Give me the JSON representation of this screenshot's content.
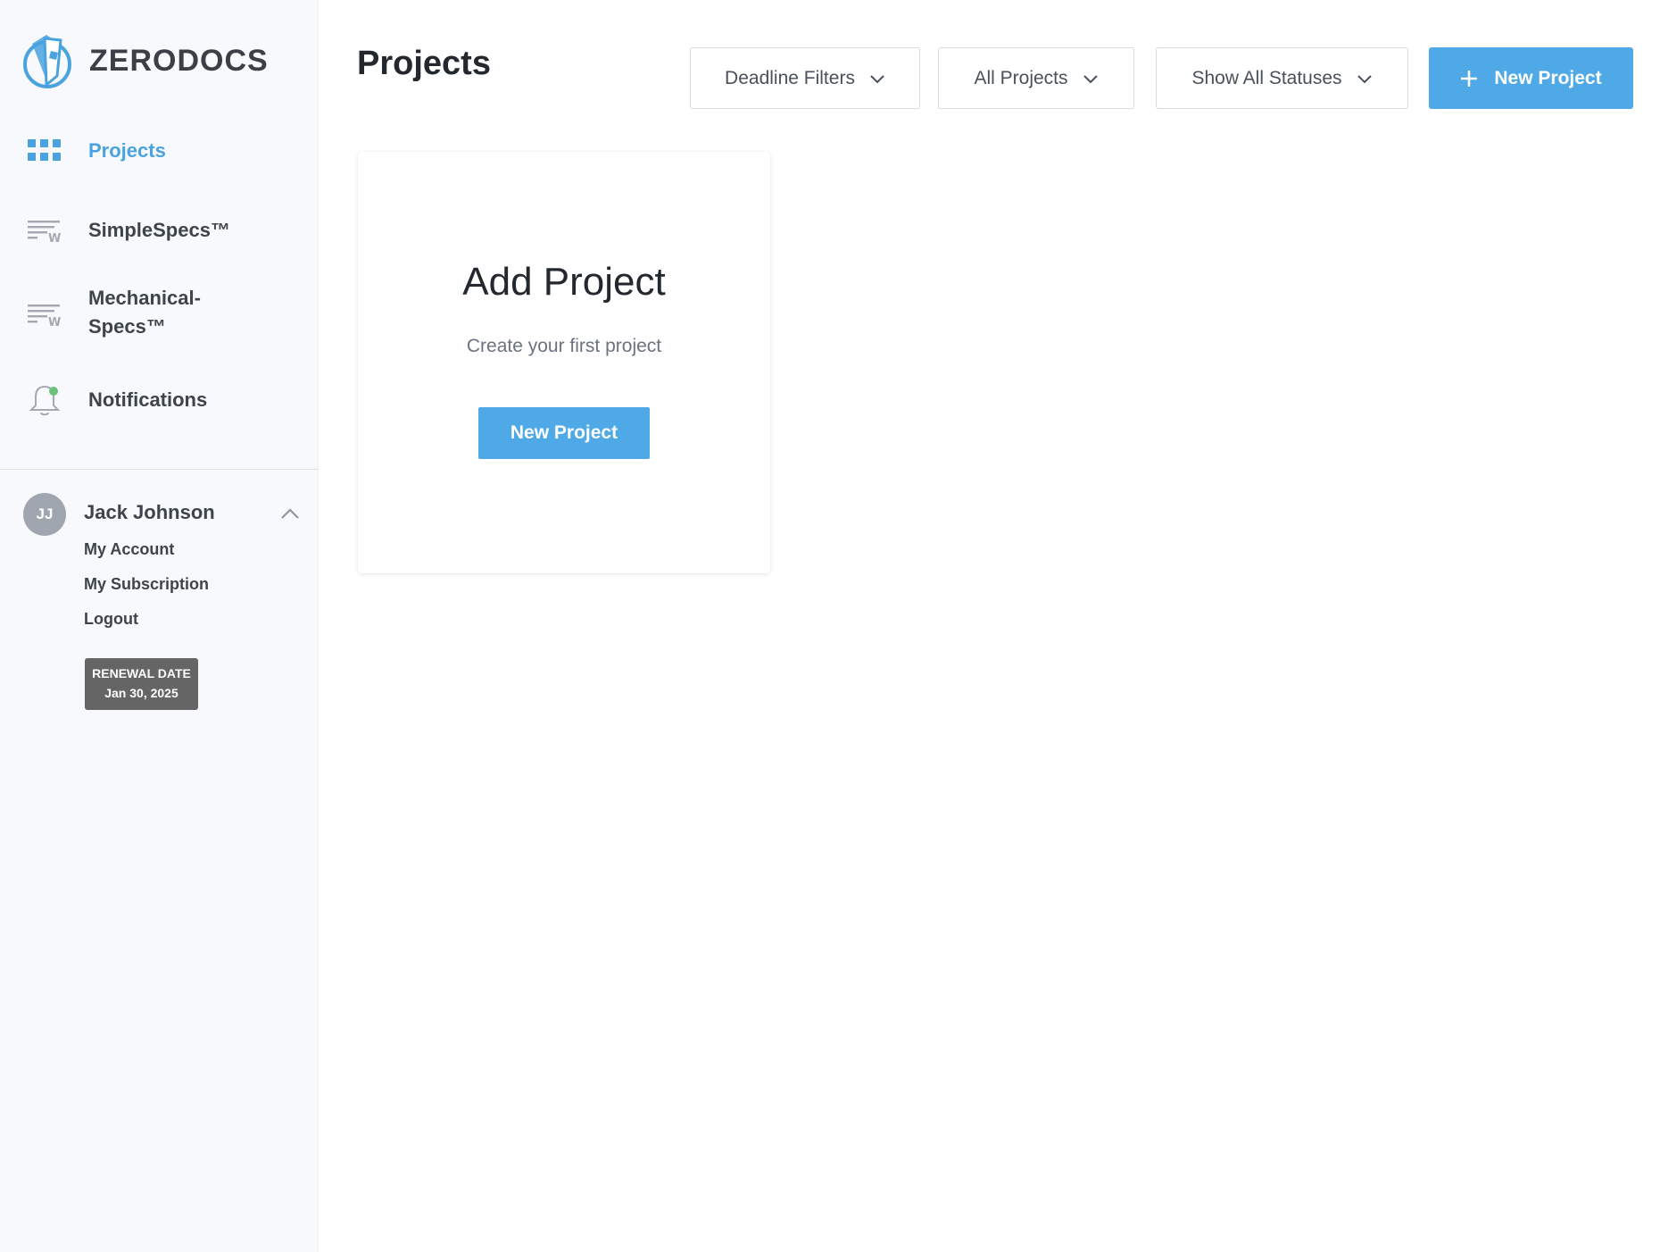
{
  "brand": {
    "name": "ZERODOCS",
    "logo_icon": "zerodocs-logo-icon"
  },
  "sidebar": {
    "accent_color": "#4aa3df",
    "items": [
      {
        "label": "Projects",
        "icon": "grid-icon",
        "active": true
      },
      {
        "label": "SimpleSpecs™",
        "icon": "specs-doc-icon",
        "active": false
      },
      {
        "label": "Mechanical-\nSpecs™",
        "icon": "specs-doc-icon",
        "active": false
      },
      {
        "label": "Notifications",
        "icon": "bell-icon",
        "active": false,
        "badge_color": "#6dc27a"
      }
    ]
  },
  "user": {
    "initials": "JJ",
    "name": "Jack Johnson",
    "menu": [
      "My Account",
      "My Subscription",
      "Logout"
    ],
    "renewal": {
      "label": "RENEWAL DATE",
      "date": "Jan 30, 2025"
    }
  },
  "header": {
    "title": "Projects",
    "filters": [
      "Deadline Filters",
      "All Projects",
      "Show All Statuses"
    ],
    "new_project_label": "New Project",
    "primary_color": "#4fa9e6"
  },
  "empty_card": {
    "title": "Add Project",
    "subtitle": "Create your first project",
    "button_label": "New Project"
  }
}
